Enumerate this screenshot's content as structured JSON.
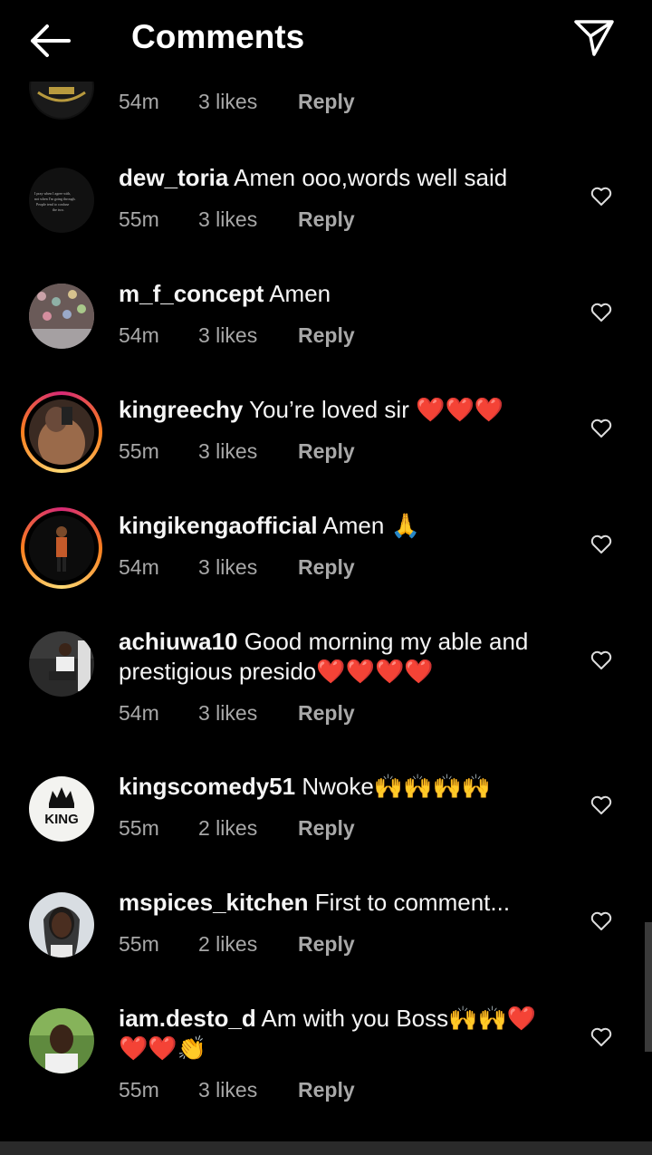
{
  "header": {
    "title": "Comments",
    "back_icon": "back-arrow-icon",
    "send_icon": "paper-plane-icon"
  },
  "comments": [
    {
      "username": "",
      "text": "",
      "time": "54m",
      "likes": "3 likes",
      "reply": "Reply"
    },
    {
      "username": "dew_toria",
      "text": "Amen ooo,words well said",
      "time": "55m",
      "likes": "3 likes",
      "reply": "Reply"
    },
    {
      "username": "m_f_concept",
      "text": "Amen",
      "time": "54m",
      "likes": "3 likes",
      "reply": "Reply"
    },
    {
      "username": "kingreechy",
      "text": "You’re loved sir ❤️❤️❤️",
      "time": "55m",
      "likes": "3 likes",
      "reply": "Reply"
    },
    {
      "username": "kingikengaofficial",
      "text": "Amen 🙏",
      "time": "54m",
      "likes": "3 likes",
      "reply": "Reply"
    },
    {
      "username": "achiuwa10",
      "text": "Good morning my able and prestigious presido❤️❤️❤️❤️",
      "time": "54m",
      "likes": "3 likes",
      "reply": "Reply"
    },
    {
      "username": "kingscomedy51",
      "text": "Nwoke🙌🙌🙌🙌",
      "time": "55m",
      "likes": "2 likes",
      "reply": "Reply"
    },
    {
      "username": "mspices_kitchen",
      "text": "First to comment...",
      "time": "55m",
      "likes": "2 likes",
      "reply": "Reply"
    },
    {
      "username": "iam.desto_d",
      "text": "Am with you Boss🙌🙌❤️❤️❤️👏",
      "time": "55m",
      "likes": "3 likes",
      "reply": "Reply"
    }
  ],
  "avatar_text": {
    "dew_toria": "I pray when I agree with, not when I'm going through. People tend to confuse the two.",
    "kingscomedy51": "KING"
  },
  "colors": {
    "background": "#000000",
    "meta": "#a8a8a8",
    "heart_red": "#e0245e"
  }
}
